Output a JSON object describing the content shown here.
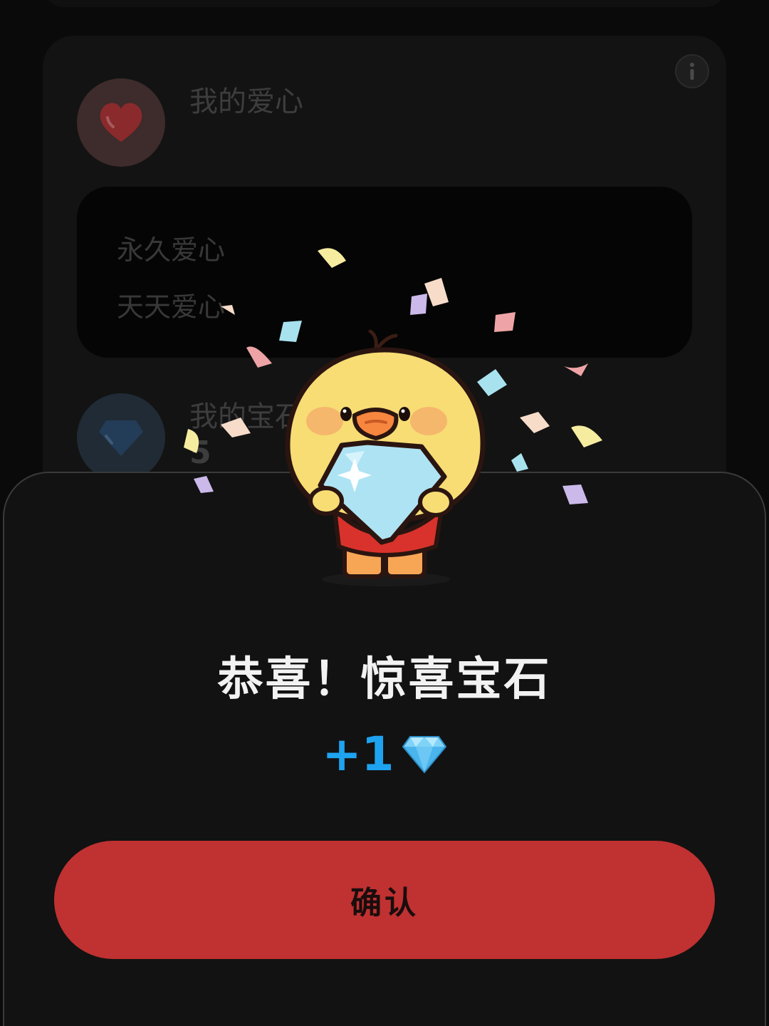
{
  "background": {
    "hearts_title": "我的爱心",
    "heart_options": [
      "永久爱心",
      "天天爱心"
    ],
    "gems_title": "我的宝石",
    "gems_count": "5"
  },
  "dialog": {
    "title": "恭喜！惊喜宝石",
    "reward_amount": "+1",
    "reward_icon": "gem-icon",
    "confirm_label": "确认"
  },
  "colors": {
    "accent_red": "#c03131",
    "reward_blue": "#1ea3f0",
    "sheet_bg": "#121212"
  }
}
